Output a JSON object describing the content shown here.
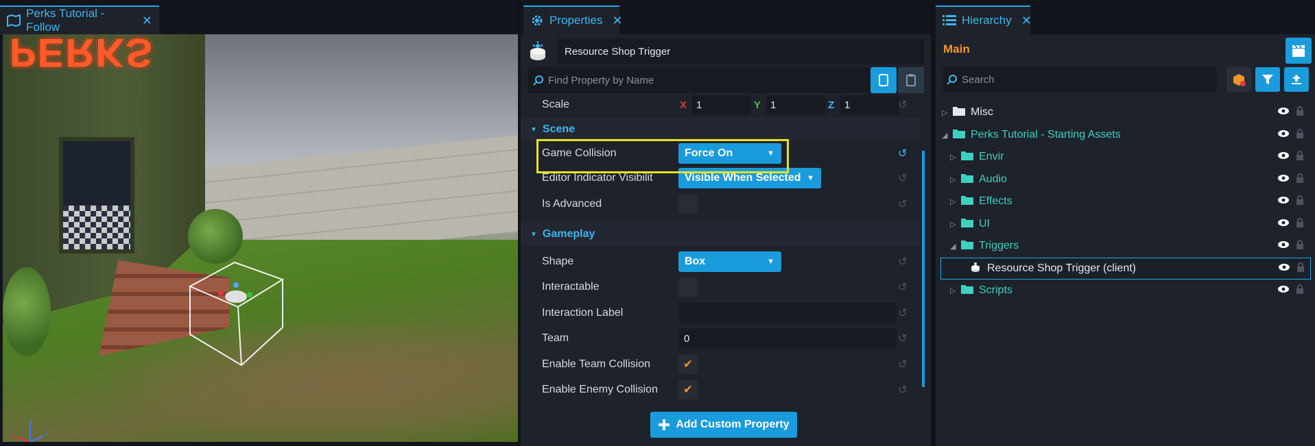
{
  "viewport": {
    "tab_label": "Perks Tutorial - Follow",
    "sign_text": "PERKS"
  },
  "properties": {
    "tab_label": "Properties",
    "object_name": "Resource Shop Trigger",
    "find_placeholder": "Find Property by Name",
    "scale": {
      "label": "Scale",
      "x": "1",
      "y": "1",
      "z": "1",
      "x_key": "X",
      "y_key": "Y",
      "z_key": "Z"
    },
    "scene": {
      "section_label": "Scene",
      "game_collision_label": "Game Collision",
      "game_collision_value": "Force On",
      "editor_indicator_label": "Editor Indicator Visibilit",
      "editor_indicator_value": "Visible When Selected",
      "is_advanced_label": "Is Advanced"
    },
    "gameplay": {
      "section_label": "Gameplay",
      "shape_label": "Shape",
      "shape_value": "Box",
      "interactable_label": "Interactable",
      "interaction_label_label": "Interaction Label",
      "interaction_label_value": "",
      "team_label": "Team",
      "team_value": "0",
      "enable_team_collision_label": "Enable Team Collision",
      "enable_enemy_collision_label": "Enable Enemy Collision"
    },
    "add_custom_property_label": "Add Custom Property"
  },
  "hierarchy": {
    "tab_label": "Hierarchy",
    "root_label": "Main",
    "search_placeholder": "Search",
    "items": [
      {
        "label": "Misc",
        "color": "#e4e8ee"
      },
      {
        "label": "Perks Tutorial - Starting Assets",
        "color": "#3fd0c0"
      },
      {
        "label": "Envir",
        "color": "#3fd0c0"
      },
      {
        "label": "Audio",
        "color": "#3fd0c0"
      },
      {
        "label": "Effects",
        "color": "#3fd0c0"
      },
      {
        "label": "UI",
        "color": "#3fd0c0"
      },
      {
        "label": "Triggers",
        "color": "#3fd0c0"
      },
      {
        "label": "Resource Shop Trigger (client)",
        "color": "#e4e8ee"
      },
      {
        "label": "Scripts",
        "color": "#3fd0c0"
      }
    ]
  },
  "colors": {
    "accent": "#1a9bdc",
    "highlight": "#e8e21c",
    "orange": "#f0962a",
    "teal": "#3fd0c0"
  }
}
